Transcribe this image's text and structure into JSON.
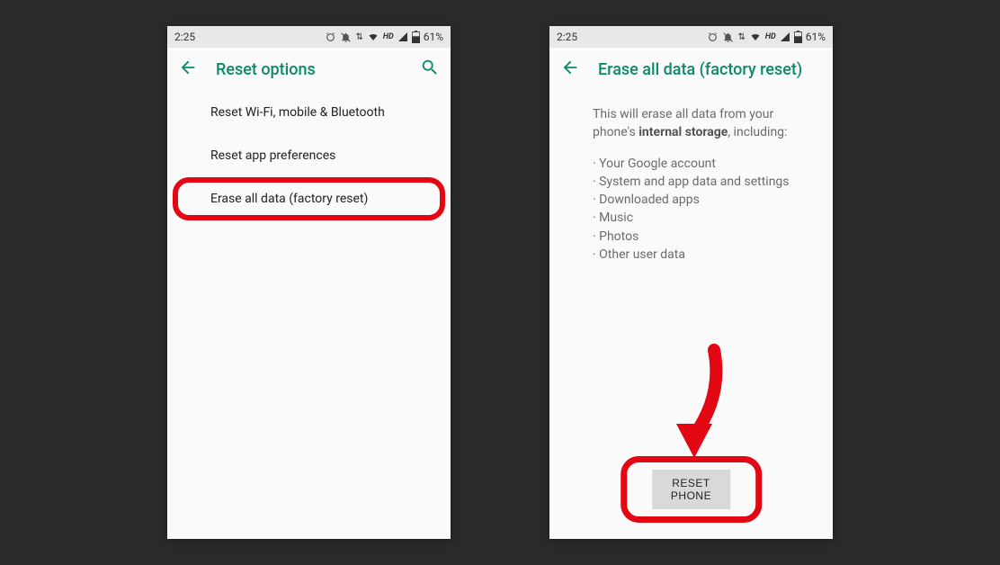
{
  "statusbar": {
    "time": "2:25",
    "battery_pct": "61%",
    "hd_label": "HD"
  },
  "screen1": {
    "title": "Reset options",
    "items": [
      "Reset Wi-Fi, mobile & Bluetooth",
      "Reset app preferences",
      "Erase all data (factory reset)"
    ]
  },
  "screen2": {
    "title": "Erase all data (factory reset)",
    "intro_pre": "This will erase all data from your phone's ",
    "intro_bold": "internal storage",
    "intro_post": ", including:",
    "bullets": [
      "Your Google account",
      "System and app data and settings",
      "Downloaded apps",
      "Music",
      "Photos",
      "Other user data"
    ],
    "reset_button": "RESET PHONE"
  },
  "colors": {
    "accent": "#0a8a6b",
    "highlight": "#e30613"
  }
}
